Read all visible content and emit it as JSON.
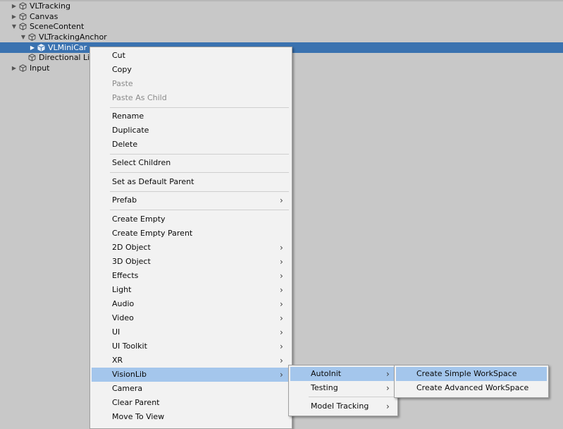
{
  "hierarchy": {
    "items": [
      {
        "label": "VLTracking",
        "arrow": "▶"
      },
      {
        "label": "Canvas",
        "arrow": "▶"
      },
      {
        "label": "SceneContent",
        "arrow": "▼"
      },
      {
        "label": "VLTrackingAnchor",
        "arrow": "▼"
      },
      {
        "label": "VLMiniCar",
        "arrow": "▶"
      },
      {
        "label": "Directional Lig",
        "arrow": ""
      },
      {
        "label": "Input",
        "arrow": "▶"
      }
    ]
  },
  "context_menu": {
    "items": [
      {
        "label": "Cut"
      },
      {
        "label": "Copy"
      },
      {
        "label": "Paste"
      },
      {
        "label": "Paste As Child"
      },
      {
        "label": "Rename"
      },
      {
        "label": "Duplicate"
      },
      {
        "label": "Delete"
      },
      {
        "label": "Select Children"
      },
      {
        "label": "Set as Default Parent"
      },
      {
        "label": "Prefab",
        "arrow": "›"
      },
      {
        "label": "Create Empty"
      },
      {
        "label": "Create Empty Parent"
      },
      {
        "label": "2D Object",
        "arrow": "›"
      },
      {
        "label": "3D Object",
        "arrow": "›"
      },
      {
        "label": "Effects",
        "arrow": "›"
      },
      {
        "label": "Light",
        "arrow": "›"
      },
      {
        "label": "Audio",
        "arrow": "›"
      },
      {
        "label": "Video",
        "arrow": "›"
      },
      {
        "label": "UI",
        "arrow": "›"
      },
      {
        "label": "UI Toolkit",
        "arrow": "›"
      },
      {
        "label": "XR",
        "arrow": "›"
      },
      {
        "label": "VisionLib",
        "arrow": "›"
      },
      {
        "label": "Camera"
      },
      {
        "label": "Clear Parent"
      },
      {
        "label": "Move To View"
      }
    ]
  },
  "visionlib_submenu": {
    "items": [
      {
        "label": "AutoInit",
        "arrow": "›"
      },
      {
        "label": "Testing",
        "arrow": "›"
      },
      {
        "label": "Model Tracking",
        "arrow": "›"
      }
    ]
  },
  "autoinit_submenu": {
    "items": [
      {
        "label": "Create Simple WorkSpace"
      },
      {
        "label": "Create Advanced WorkSpace"
      }
    ]
  },
  "colors": {
    "selection": "#3a72b0",
    "menu_highlight": "#a4c6ec",
    "menu_bg": "#f2f2f2",
    "panel_bg": "#c8c8c8"
  }
}
